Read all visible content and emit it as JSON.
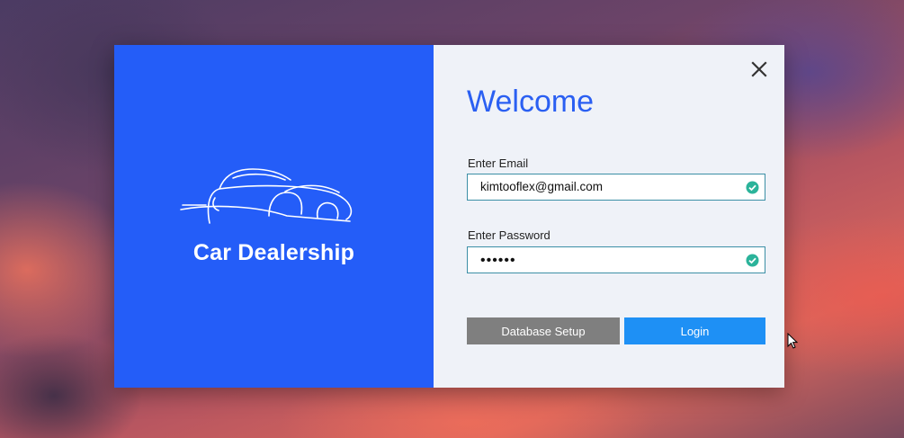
{
  "app": {
    "brand_title": "Car Dealership"
  },
  "form": {
    "heading": "Welcome",
    "email_label": "Enter Email",
    "email_value": "kimtooflex@gmail.com",
    "password_label": "Enter Password",
    "password_value": "••••••",
    "database_setup_label": "Database Setup",
    "login_label": "Login"
  },
  "icons": {
    "close": "close-icon",
    "email_valid": "check-circle-icon",
    "password_valid": "check-circle-icon",
    "logo": "car-logo-icon",
    "cursor": "mouse-pointer-icon"
  },
  "colors": {
    "brand_panel": "#245df8",
    "form_panel": "#eff2f8",
    "heading": "#2a5ff2",
    "input_border": "#3c8fa6",
    "valid_check": "#2bb39a",
    "database_setup_button": "#7f7f7f",
    "login_button": "#1e90f5"
  }
}
